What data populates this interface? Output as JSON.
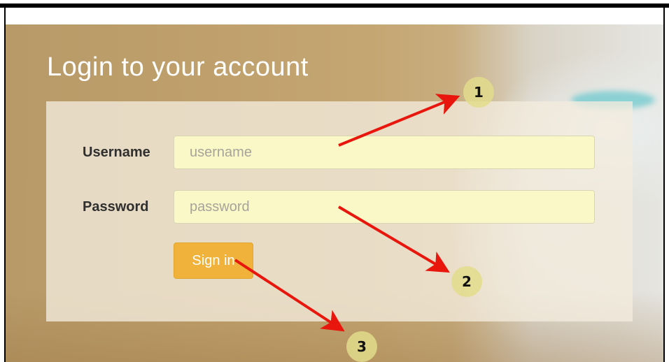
{
  "page": {
    "title": "Login to your account"
  },
  "form": {
    "username_label": "Username",
    "username_placeholder": "username",
    "username_value": "",
    "password_label": "Password",
    "password_placeholder": "password",
    "password_value": "",
    "signin_label": "Sign in"
  },
  "annotations": [
    {
      "number": "1",
      "target": "username-field"
    },
    {
      "number": "2",
      "target": "password-field"
    },
    {
      "number": "3",
      "target": "signin-button"
    }
  ],
  "colors": {
    "arrow": "#e8160c",
    "button": "#f0b23a",
    "field_bg": "#fbf8c8",
    "badge": "#e2dc8c"
  }
}
